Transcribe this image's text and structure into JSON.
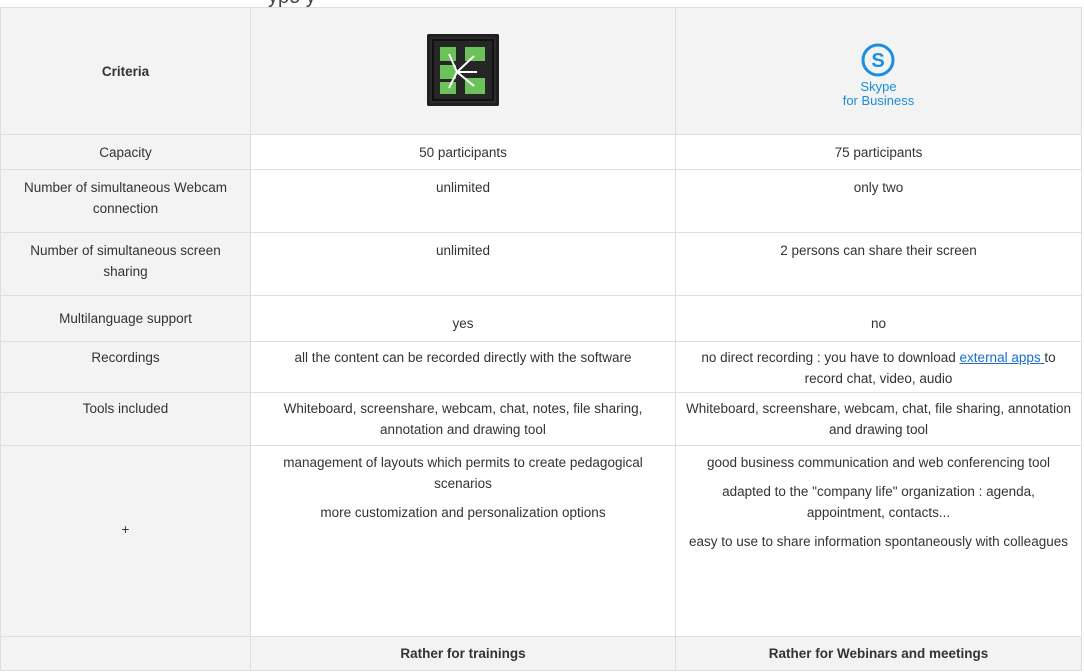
{
  "heading_fragment": "ypo              y",
  "table": {
    "criteria_header": "Criteria",
    "product_a": {
      "logo": "adobe-connect-logo"
    },
    "product_b": {
      "logo": "skype-logo",
      "name_line1": "Skype",
      "name_line2": "for Business"
    },
    "rows": [
      {
        "label": "Capacity",
        "a": "50 participants",
        "b": "75 participants"
      },
      {
        "label": "Number of simultaneous Webcam connection",
        "a": "unlimited",
        "b": "only two"
      },
      {
        "label": "Number of simultaneous screen sharing",
        "a": "unlimited",
        "b": "2 persons can share their screen"
      },
      {
        "label": "Multilanguage support",
        "a": "yes",
        "b": "no"
      },
      {
        "label": "Recordings",
        "a": "all the content can be recorded directly with the software",
        "b_before": "no direct recording : you have to download ",
        "b_link": "external apps ",
        "b_after": "to record chat, video, audio"
      },
      {
        "label": "Tools included",
        "a": "Whiteboard, screenshare, webcam, chat, notes, file sharing, annotation and drawing tool",
        "b": "Whiteboard, screenshare, webcam, chat, file sharing, annotation and drawing tool"
      },
      {
        "label": "+",
        "a_points": [
          "management of layouts which permits to create pedagogical scenarios",
          "more customization and personalization options"
        ],
        "b_points": [
          "good business communication and web conferencing tool",
          "adapted to the \"company life\" organization : agenda, appointment, contacts...",
          "easy to use to share information spontaneously with colleagues"
        ]
      },
      {
        "label": "",
        "a": "Rather for trainings",
        "b": "Rather for Webinars and meetings"
      }
    ]
  },
  "colors": {
    "header_bg": "#f3f3f3",
    "border": "#dedede",
    "link": "#1a6fd0",
    "skype_blue": "#1a8fe0",
    "connect_bg": "#2b2b2b",
    "connect_green": "#6ac259"
  }
}
